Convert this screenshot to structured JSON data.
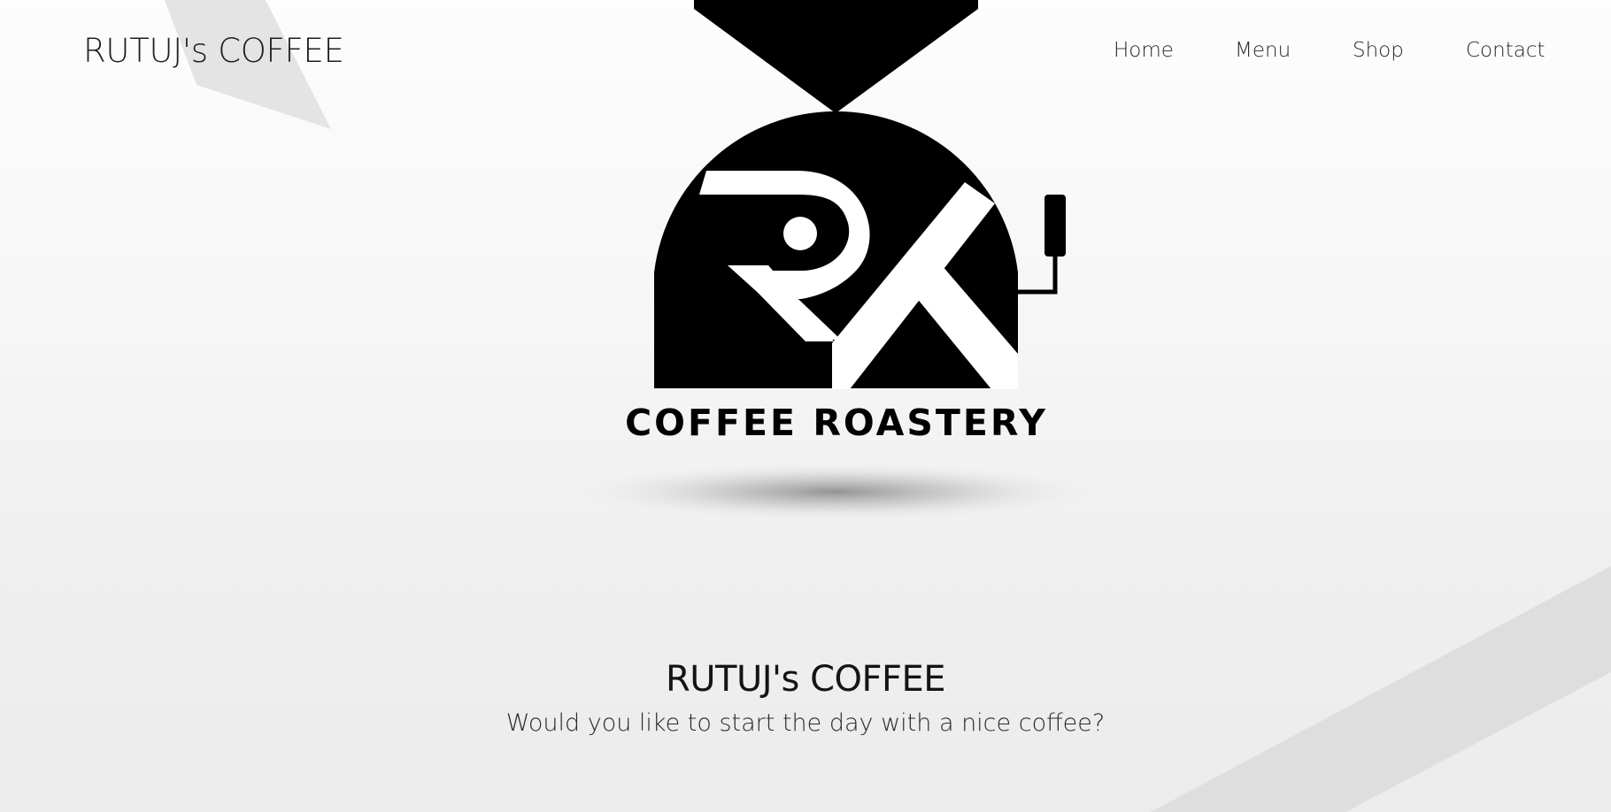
{
  "header": {
    "brand": "RUTUJ's COFFEE",
    "nav": [
      {
        "label": "Home"
      },
      {
        "label": "Menu"
      },
      {
        "label": "Shop"
      },
      {
        "label": "Contact"
      }
    ]
  },
  "hero": {
    "logo": {
      "icon": "coffee-roaster-rk-logo",
      "caption": "COFFEE ROASTERY"
    },
    "title": "RUTUJ's COFFEE",
    "subtitle": "Would you like to start the day with a nice coffee?"
  },
  "colors": {
    "background": "#f2f2f2",
    "text": "#1e1e1e",
    "logo": "#000000",
    "decor": "#dedede"
  }
}
